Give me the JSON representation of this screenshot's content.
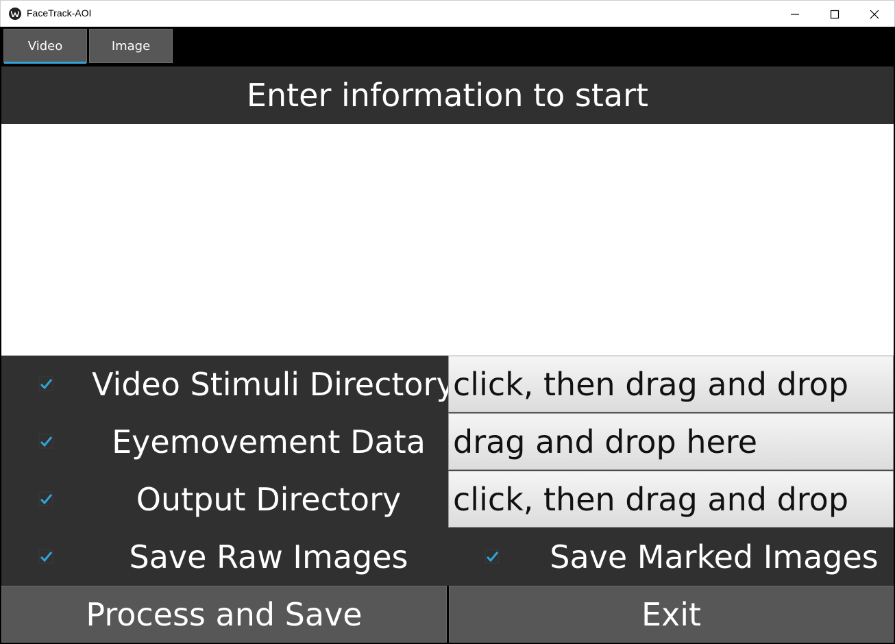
{
  "window": {
    "title": "FaceTrack-AOI"
  },
  "tabs": [
    {
      "label": "Video",
      "active": true
    },
    {
      "label": "Image",
      "active": false
    }
  ],
  "header": {
    "title": "Enter information to start"
  },
  "form": {
    "video_stimuli": {
      "label": "Video Stimuli Directory",
      "checked": true,
      "field_text": "click, then drag and drop"
    },
    "eyemovement": {
      "label": "Eyemovement Data",
      "checked": true,
      "field_text": "drag and drop here"
    },
    "output_dir": {
      "label": "Output Directory",
      "checked": true,
      "field_text": "click, then drag and drop"
    },
    "save_raw": {
      "label": "Save Raw Images",
      "checked": true
    },
    "save_marked": {
      "label": "Save Marked Images",
      "checked": true
    }
  },
  "actions": {
    "process_label": "Process and Save",
    "exit_label": "Exit"
  },
  "colors": {
    "accent": "#31a3d9",
    "panel": "#303030",
    "button": "#575757"
  }
}
